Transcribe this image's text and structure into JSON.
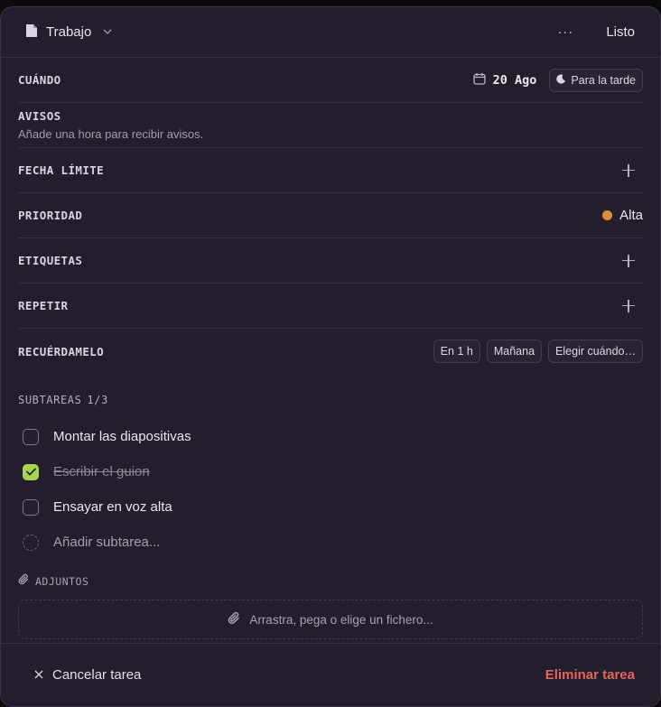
{
  "header": {
    "project": "Trabajo",
    "more_label": "···",
    "done_label": "Listo"
  },
  "when": {
    "label": "CUÁNDO",
    "date": "20 Ago",
    "time_chip": "Para la tarde"
  },
  "reminders": {
    "label": "AVISOS",
    "hint": "Añade una hora para recibir avisos."
  },
  "deadline": {
    "label": "FECHA LÍMITE"
  },
  "priority": {
    "label": "PRIORIDAD",
    "value": "Alta",
    "color": "#e08a3a"
  },
  "tags": {
    "label": "ETIQUETAS"
  },
  "repeat": {
    "label": "REPETIR"
  },
  "remind_me": {
    "label": "RECUÉRDAMELO",
    "options": [
      "En 1 h",
      "Mañana",
      "Elegir cuándo…"
    ]
  },
  "subtasks": {
    "label": "SUBTAREAS",
    "count": "1/3",
    "items": [
      {
        "text": "Montar las diapositivas",
        "done": false
      },
      {
        "text": "Escribir el guion",
        "done": true
      },
      {
        "text": "Ensayar en voz alta",
        "done": false
      }
    ],
    "add_placeholder": "Añadir subtarea..."
  },
  "attachments": {
    "label": "ADJUNTOS",
    "dropzone": "Arrastra, pega o elige un fichero..."
  },
  "footer": {
    "cancel": "Cancelar tarea",
    "delete": "Eliminar tarea"
  },
  "colors": {
    "accent_check": "#a8d654",
    "danger": "#e0675f"
  }
}
